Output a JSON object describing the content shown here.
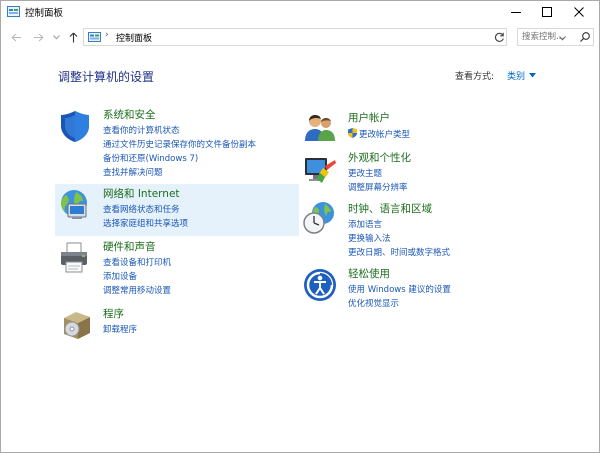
{
  "window": {
    "title": "控制面板"
  },
  "nav": {
    "address_label": "控制面板",
    "search_placeholder": "搜索控制..."
  },
  "main": {
    "heading": "调整计算机的设置",
    "view_by_label": "查看方式:",
    "view_by_value": "类别"
  },
  "left_categories": [
    {
      "title": "系统和安全",
      "links": [
        "查看你的计算机状态",
        "通过文件历史记录保存你的文件备份副本",
        "备份和还原(Windows 7)",
        "查找并解决问题"
      ]
    },
    {
      "title": "网络和 Internet",
      "links": [
        "查看网络状态和任务",
        "选择家庭组和共享选项"
      ]
    },
    {
      "title": "硬件和声音",
      "links": [
        "查看设备和打印机",
        "添加设备",
        "调整常用移动设置"
      ]
    },
    {
      "title": "程序",
      "links": [
        "卸载程序"
      ]
    }
  ],
  "right_categories": [
    {
      "title": "用户帐户",
      "links": [
        "更改帐户类型"
      ]
    },
    {
      "title": "外观和个性化",
      "links": [
        "更改主题",
        "调整屏幕分辨率"
      ]
    },
    {
      "title": "时钟、语言和区域",
      "links": [
        "添加语言",
        "更换输入法",
        "更改日期、时间或数字格式"
      ]
    },
    {
      "title": "轻松使用",
      "links": [
        "使用 Windows 建议的设置",
        "优化视觉显示"
      ]
    }
  ]
}
